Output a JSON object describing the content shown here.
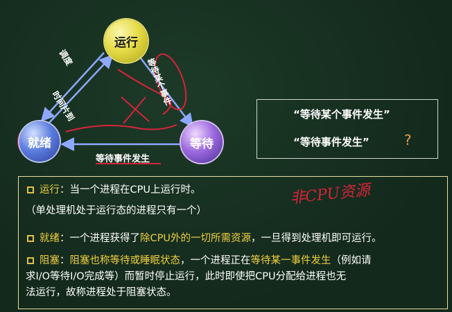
{
  "diagram": {
    "nodes": {
      "running": "运行",
      "ready": "就绪",
      "waiting": "等待"
    },
    "edges": {
      "dispatch": "调度",
      "timeout": "时间片到",
      "wait_event": "等待某个事件",
      "event_occurs": "等待事件发生"
    }
  },
  "note": {
    "line1": "“等待某个事件发生”",
    "line2": "“等待事件发生”",
    "question": "?"
  },
  "handwriting": "非CPU资源",
  "content": {
    "running_term": "运行",
    "running_desc": "：当一个进程在CPU上运行时。",
    "running_note": "（单处理机处于运行态的进程只有一个）",
    "ready_term": "就绪",
    "ready_desc_a": "：一个进程获得了",
    "ready_hl": "除CPU外的一切所需资源",
    "ready_desc_b": "，一旦得到处理机即可运行。",
    "blocked_term": "阻塞",
    "blocked_desc_a": "：",
    "blocked_hl1": "阻塞也称等待或睡眠状态",
    "blocked_desc_b": "，一个进程正在",
    "blocked_hl2": "等待某一事件发生",
    "blocked_desc_c": "（例如请",
    "blocked_line2": "求I/O等待I/O完成等）而暂时停止运行，此时即使把CPU分配给进程也无",
    "blocked_line3": "法运行，故称进程处于阻塞状态。"
  },
  "colors": {
    "board": "#13291c",
    "accent": "#f0d040",
    "ink": "#d8233a"
  }
}
